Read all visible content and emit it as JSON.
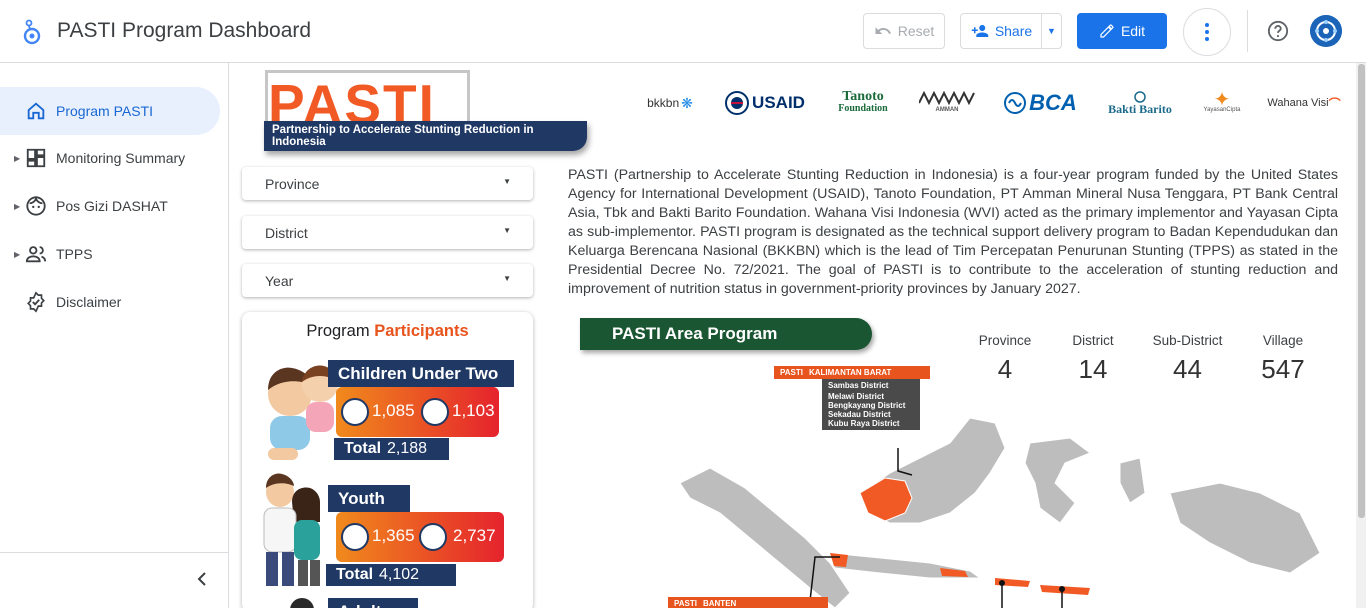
{
  "header": {
    "title": "PASTI Program Dashboard",
    "reset_label": "Reset",
    "share_label": "Share",
    "edit_label": "Edit"
  },
  "sidebar": {
    "items": [
      {
        "label": "Program PASTI",
        "icon": "home-icon",
        "active": true
      },
      {
        "label": "Monitoring Summary",
        "icon": "dashboard-icon"
      },
      {
        "label": "Pos Gizi DASHAT",
        "icon": "face-icon"
      },
      {
        "label": "TPPS",
        "icon": "people-icon"
      },
      {
        "label": "Disclaimer",
        "icon": "verified-icon"
      }
    ]
  },
  "logo": {
    "word": "PASTI",
    "tagline": "Partnership to Accelerate Stunting Reduction in Indonesia"
  },
  "sponsors": [
    "bkkbn",
    "USAID",
    "Tanoto",
    "Foundation",
    "AMMAN",
    "BCA",
    "Bakti Barito",
    "YayasanCipta",
    "Wahana Visi"
  ],
  "filters": {
    "province": "Province",
    "district": "District",
    "year": "Year"
  },
  "description": "PASTI (Partnership to Accelerate Stunting Reduction in Indonesia) is a four-year program funded by the United States Agency for International Development (USAID), Tanoto Foundation, PT Amman Mineral Nusa Tenggara, PT Bank Central Asia, Tbk and Bakti Barito Foundation. Wahana Visi Indonesia (WVI) acted as the primary implementor and Yayasan Cipta as sub-implementor. PASTI program is designated as the technical support delivery program to Badan Kependudukan dan Keluarga Berencana Nasional (BKKBN) which is the lead of Tim Percepatan Penurunan Stunting (TPPS) as stated in the Presidential Decree No. 72/2021. The goal of PASTI is to contribute to the acceleration of stunting reduction and improvement of nutrition status in government-priority provinces by January 2027.",
  "participants": {
    "title_prefix": "Program",
    "title_highlight": "Participants",
    "children": {
      "label": "Children Under Two",
      "male": "1,085",
      "female": "1,103",
      "total_label": "Total",
      "total": "2,188"
    },
    "youth": {
      "label": "Youth",
      "male": "1,365",
      "female": "2,737",
      "total_label": "Total",
      "total": "4,102"
    },
    "adult": {
      "label": "Adult"
    }
  },
  "area": {
    "banner": "PASTI Area Program",
    "stats": [
      {
        "label": "Province",
        "value": "4"
      },
      {
        "label": "District",
        "value": "14"
      },
      {
        "label": "Sub-District",
        "value": "44"
      },
      {
        "label": "Village",
        "value": "547"
      }
    ],
    "kalbar": {
      "tag": "PASTI",
      "province": "KALIMANTAN BARAT",
      "districts": [
        "Sambas District",
        "Melawi District",
        "Bengkayang District",
        "Sekadau District",
        "Kubu Raya District"
      ]
    },
    "banten": {
      "tag": "PASTI",
      "province": "BANTEN"
    }
  },
  "colors": {
    "accent": "#1a73e8",
    "pasti_orange": "#f15a24",
    "navy": "#1f3864",
    "green": "#1a5632"
  }
}
